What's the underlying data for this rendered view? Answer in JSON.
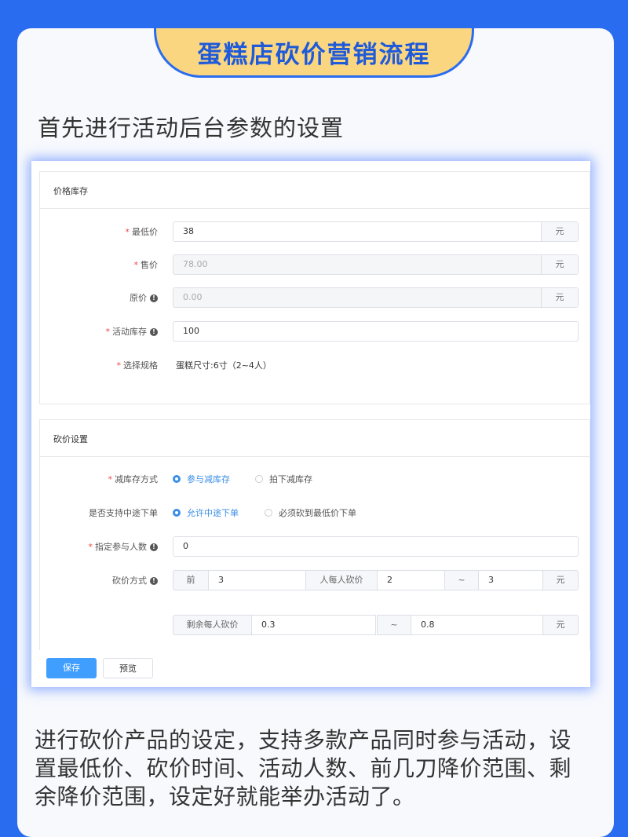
{
  "banner": {
    "title": "蛋糕店砍价营销流程"
  },
  "intro": "首先进行活动后台参数的设置",
  "price_stock": {
    "header": "价格库存",
    "min_price": {
      "label": "最低价",
      "value": "38",
      "unit": "元"
    },
    "sale_price": {
      "label": "售价",
      "value": "78.00",
      "unit": "元"
    },
    "orig_price": {
      "label": "原价",
      "value": "0.00",
      "unit": "元"
    },
    "stock": {
      "label": "活动库存",
      "value": "100"
    },
    "spec": {
      "label": "选择规格",
      "value": "蛋糕尺寸:6寸（2~4人）"
    }
  },
  "bargain": {
    "header": "砍价设置",
    "reduce_mode": {
      "label": "减库存方式",
      "opt1": "参与减库存",
      "opt2": "拍下减库存"
    },
    "midway": {
      "label": "是否支持中途下单",
      "opt1": "允许中途下单",
      "opt2": "必须砍到最低价下单"
    },
    "participants": {
      "label": "指定参与人数",
      "value": "0"
    },
    "mode": {
      "label": "砍价方式",
      "prefix": "前",
      "first_n": "3",
      "per_person": "人每人砍价",
      "min": "2",
      "tilde": "~",
      "max": "3",
      "unit": "元",
      "rest_label": "剩余每人砍价",
      "rest_min": "0.3",
      "rest_tilde": "~",
      "rest_max": "0.8",
      "rest_unit": "元"
    }
  },
  "buttons": {
    "save": "保存",
    "preview": "预览"
  },
  "description": "进行砍价产品的设定，支持多款产品同时参与活动，设置最低价、砍价时间、活动人数、前几刀降价范围、剩余降价范围，设定好就能举办活动了。",
  "colors": {
    "accent": "#2a6cf0",
    "banner": "#fbd680",
    "primary_button": "#409eff",
    "required": "#f04848"
  }
}
